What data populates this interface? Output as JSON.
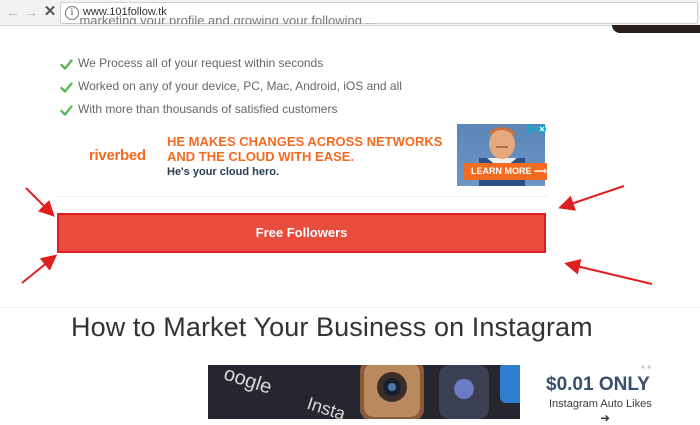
{
  "browser": {
    "url": "www.101follow.tk",
    "back_icon": "←",
    "forward_icon": "→",
    "stop_icon": "✕",
    "info_icon": "i"
  },
  "page": {
    "partial_text": "... marketing your profile and growing your following ...",
    "features": [
      {
        "icon": "check-icon",
        "text": "We Process all of your request within seconds"
      },
      {
        "icon": "check-icon",
        "text": "Worked on any of your device, PC, Mac, Android, iOS and all"
      },
      {
        "icon": "check-icon",
        "text": "With more than thousands of satisfied customers"
      }
    ],
    "ad": {
      "brand": "riverbed",
      "headline_line1": "HE MAKES CHANGES ACROSS NETWORKS",
      "headline_line2": "AND THE CLOUD WITH EASE.",
      "subline": "He's your cloud hero.",
      "cta": "LEARN MORE ⟶"
    },
    "primary_button": "Free Followers",
    "heading": "How to Market Your Business on Instagram",
    "article_image_text": {
      "a": "oogle",
      "b": "Insta"
    },
    "side_promo": {
      "price": "$0.01 ONLY",
      "text": "Instagram Auto Likes",
      "arrow": "➜"
    }
  },
  "colors": {
    "check": "#5cb85c",
    "button": "#e84c3d",
    "arrow_annotation": "#e02020",
    "ad_orange": "#f36b21"
  }
}
